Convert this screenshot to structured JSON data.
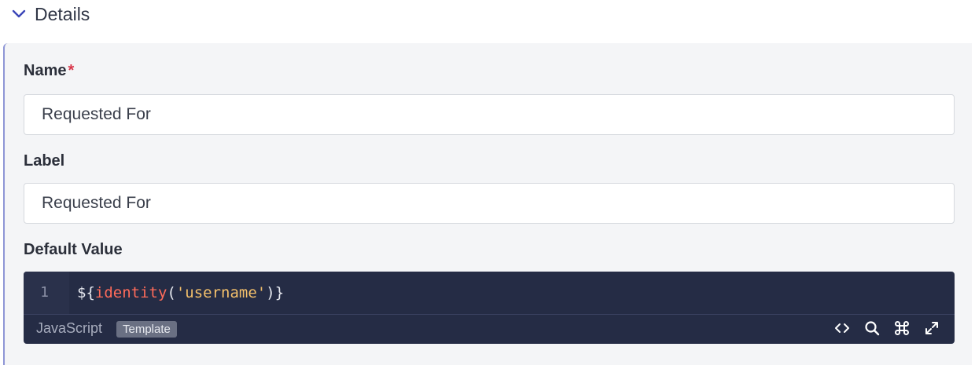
{
  "section": {
    "title": "Details",
    "expanded": true,
    "icon": "chevron-down-icon"
  },
  "fields": {
    "name": {
      "label": "Name",
      "required_marker": "*",
      "value": "Requested For"
    },
    "label": {
      "label": "Label",
      "value": "Requested For"
    },
    "default_value": {
      "label": "Default Value",
      "line_number": "1",
      "code": {
        "prefix": "${",
        "fn": "identity",
        "open": "(",
        "str": "'username'",
        "close": ")}"
      },
      "language": "JavaScript",
      "mode_badge": "Template",
      "tools": [
        "code-icon",
        "search-icon",
        "command-icon",
        "expand-icon"
      ]
    }
  },
  "colors": {
    "accent": "#8e96d6",
    "required": "#d9374b",
    "editor_bg": "#252c45",
    "token_function": "#ff6b5a",
    "token_string": "#f4c06b"
  }
}
